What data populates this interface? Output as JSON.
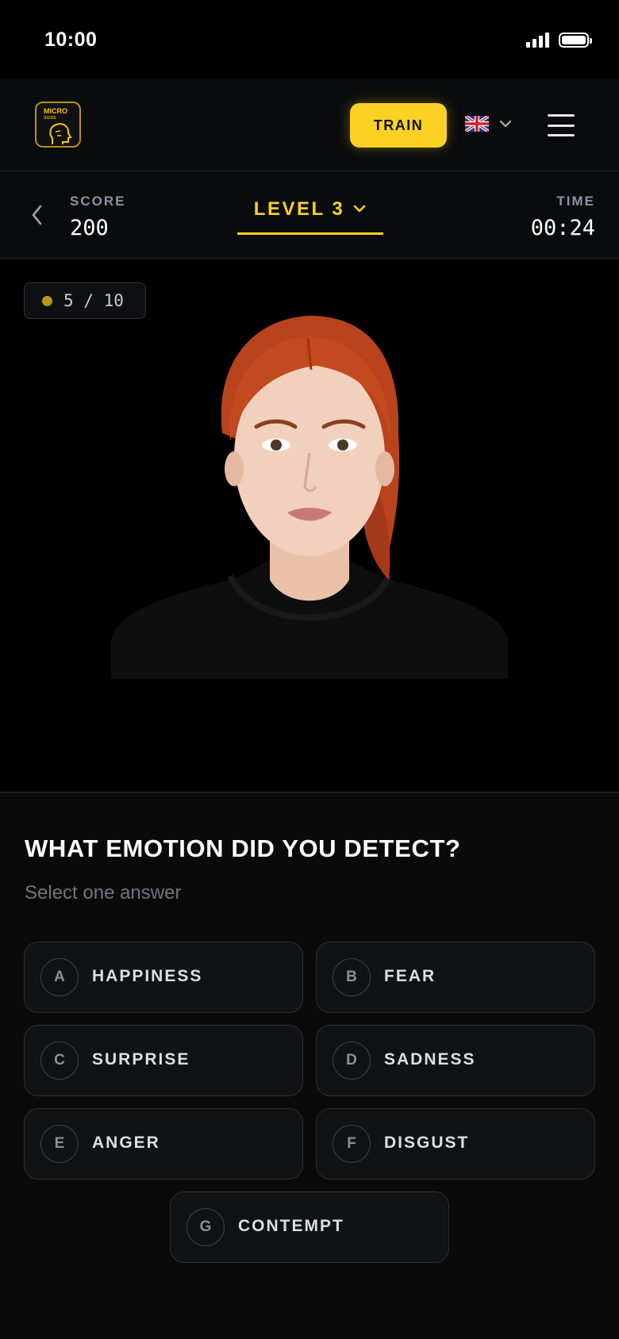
{
  "status_bar": {
    "time": "10:00"
  },
  "header": {
    "logo_text": "MICRO",
    "logo_subtext": "SIGNS",
    "train_label": "TRAIN",
    "language_icon": "uk-flag-icon"
  },
  "score_bar": {
    "score_label": "SCORE",
    "score_value": "200",
    "level_label": "LEVEL 3",
    "time_label": "TIME",
    "time_value": "00:24"
  },
  "stage": {
    "progress_text": "5 / 10",
    "image_icon": "face-portrait"
  },
  "quiz": {
    "question": "WHAT EMOTION DID YOU DETECT?",
    "hint": "Select one answer",
    "options": [
      {
        "letter": "A",
        "label": "HAPPINESS"
      },
      {
        "letter": "B",
        "label": "FEAR"
      },
      {
        "letter": "C",
        "label": "SURPRISE"
      },
      {
        "letter": "D",
        "label": "SADNESS"
      },
      {
        "letter": "E",
        "label": "ANGER"
      },
      {
        "letter": "F",
        "label": "DISGUST"
      },
      {
        "letter": "G",
        "label": "CONTEMPT"
      }
    ]
  },
  "colors": {
    "accent": "#fbd123",
    "background": "#000000",
    "panel": "#0a0b0d"
  }
}
